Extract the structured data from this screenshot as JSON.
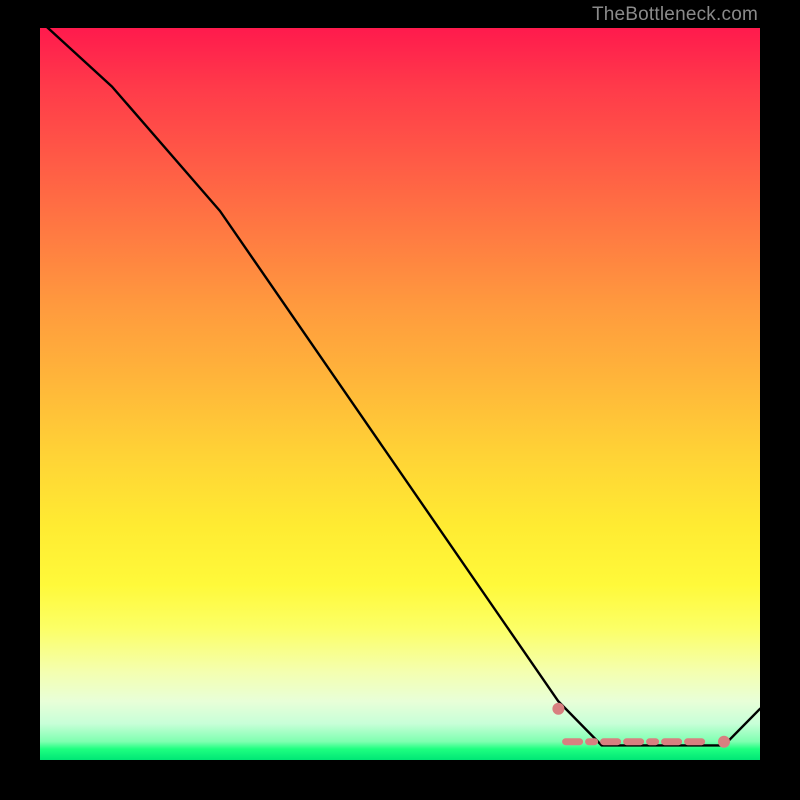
{
  "watermark": "TheBottleneck.com",
  "chart_data": {
    "type": "line",
    "title": "",
    "xlabel": "",
    "ylabel": "",
    "xlim": [
      0,
      100
    ],
    "ylim": [
      0,
      100
    ],
    "series": [
      {
        "name": "bottleneck-curve",
        "color": "#000000",
        "x": [
          0,
          10,
          25,
          72,
          78,
          92,
          95,
          100
        ],
        "y": [
          101,
          92,
          75,
          8,
          2,
          2,
          2,
          7
        ]
      }
    ],
    "highlights": [
      {
        "name": "optimal-range-left-cap",
        "type": "dot",
        "color": "#d88080",
        "x": 72,
        "y": 7
      },
      {
        "name": "optimal-range-dash",
        "type": "dash",
        "color": "#d88080",
        "x0": 73,
        "x1": 92,
        "y": 2.5
      },
      {
        "name": "optimal-range-right-dot",
        "type": "dot",
        "color": "#d88080",
        "x": 95,
        "y": 2.5
      }
    ]
  }
}
